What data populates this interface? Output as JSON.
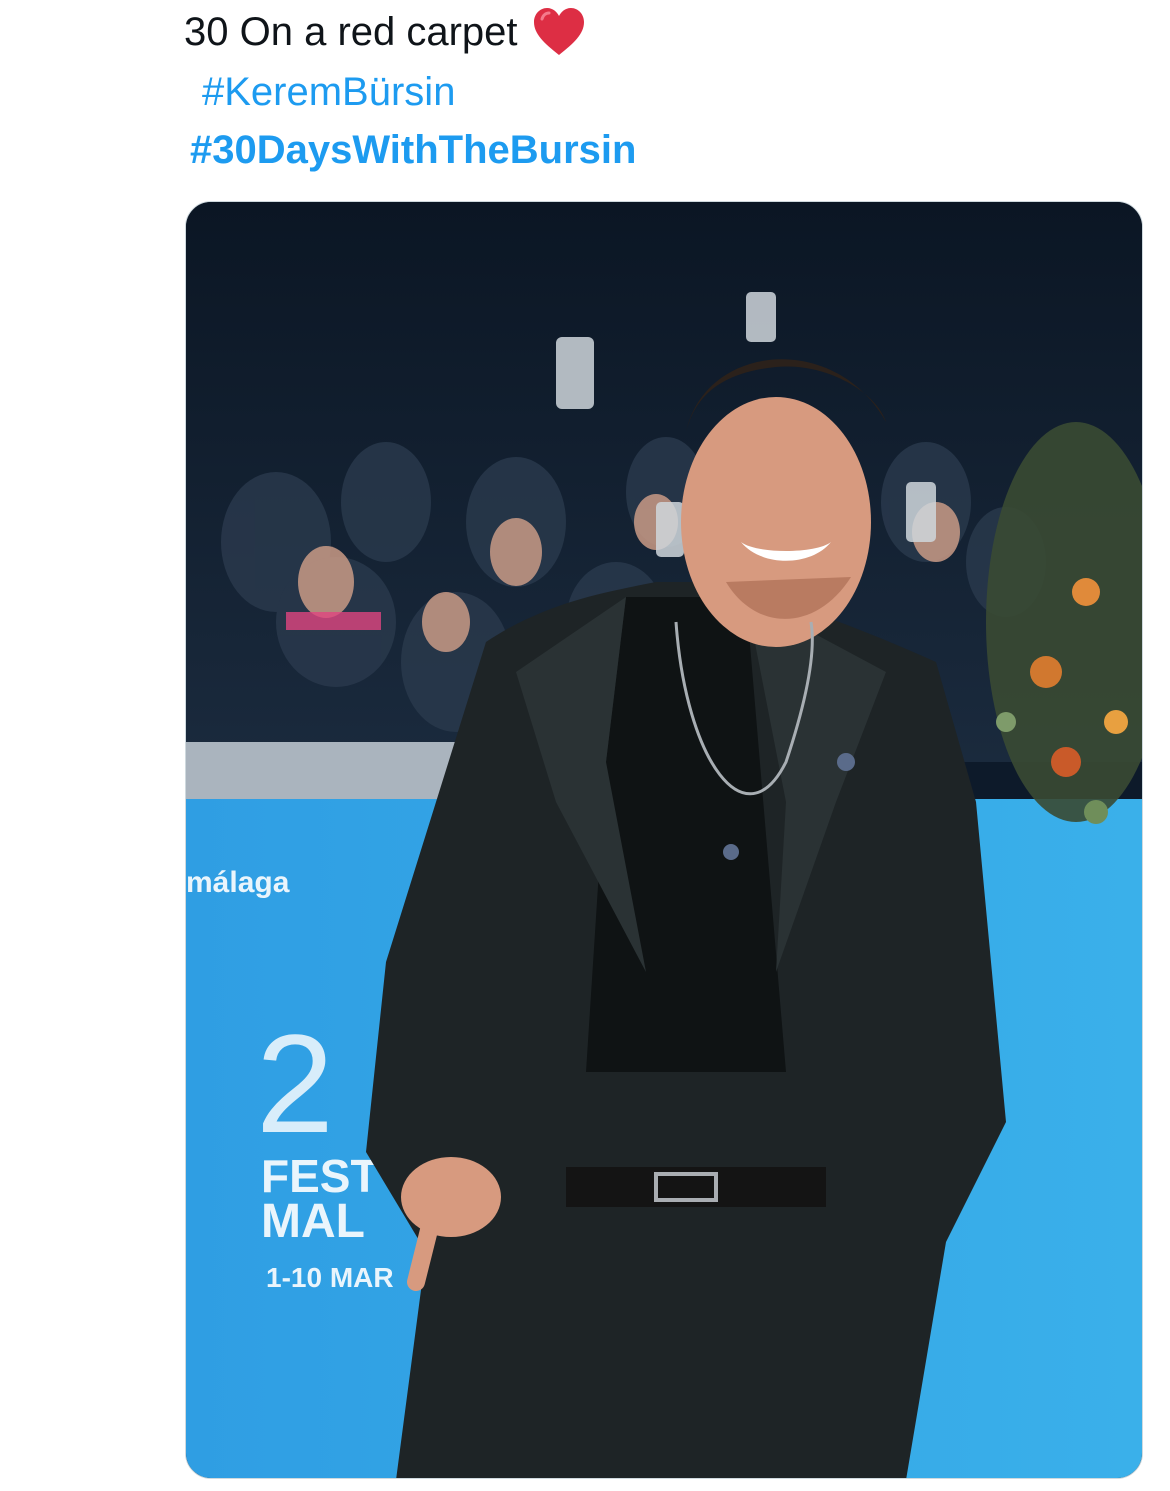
{
  "post": {
    "line1": "30 On a red carpet",
    "hashtag1": "#KeremBürsin",
    "hashtag2": "#30DaysWithTheBursin"
  },
  "icons": {
    "heart": "red-heart-emoji"
  },
  "media": {
    "backdrop_text": {
      "brand": "málaga",
      "number": "2",
      "fest": "FEST",
      "city": "MAL",
      "dates": "1-10 MAR"
    }
  },
  "colors": {
    "accent": "#1d9bf0",
    "text": "#0f1419",
    "heart": "#e0245e",
    "backdrop": "#3aa0e0"
  }
}
